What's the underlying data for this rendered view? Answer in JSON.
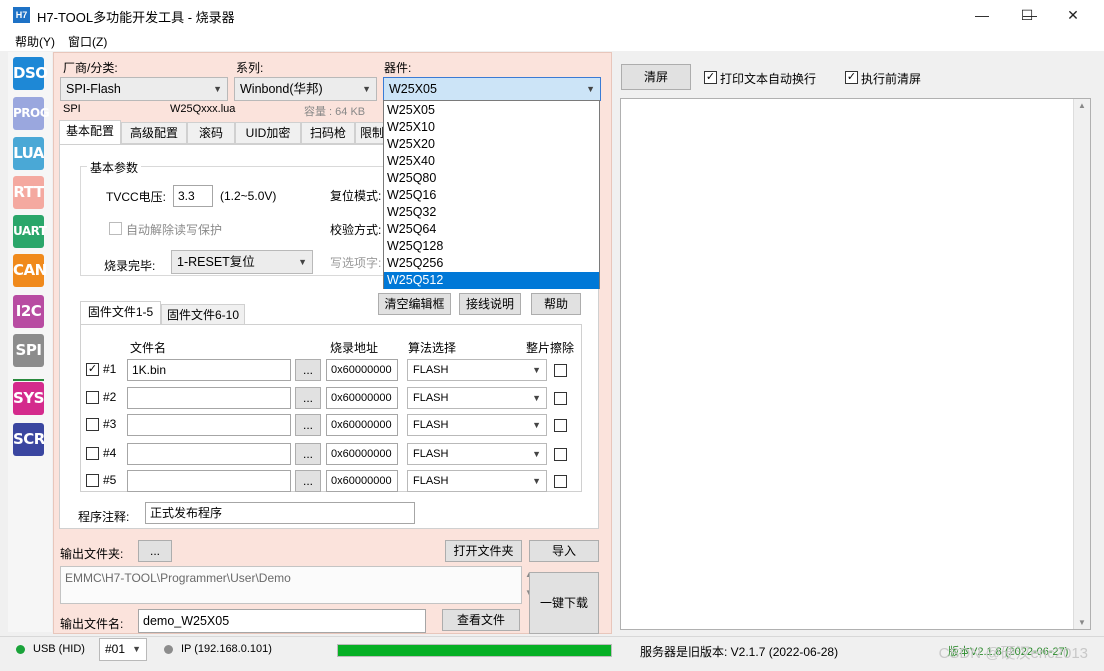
{
  "window": {
    "icon_text": "H7",
    "title": "H7-TOOL多功能开发工具 - 烧录器",
    "minimize": "—",
    "maximize": "☐",
    "close": "✕"
  },
  "menu": [
    "帮助(Y)",
    "窗口(Z)"
  ],
  "sidebar": [
    {
      "label": "DSO",
      "color": "#1e88d6"
    },
    {
      "label": "PROG",
      "color": "#9aa7de"
    },
    {
      "label": "LUA",
      "color": "#4aa8d6"
    },
    {
      "label": "RTT",
      "color": "#f4a9a0"
    },
    {
      "label": "UART",
      "color": "#2aa66a"
    },
    {
      "label": "CAN",
      "color": "#f08a1c"
    },
    {
      "label": "I2C",
      "color": "#b84ca2"
    },
    {
      "label": "SPI",
      "color": "#8c8c8c"
    },
    {
      "label": "SYS",
      "color": "#d42a8c"
    },
    {
      "label": "SCR",
      "color": "#3a46a0"
    }
  ],
  "device": {
    "vendor_label": "厂商/分类:",
    "vendor_value": "SPI-Flash",
    "series_label": "系列:",
    "series_value": "Winbond(华邦)",
    "chip_label": "器件:",
    "chip_value": "W25X05",
    "info_type": "SPI",
    "info_lua": "W25Qxxx.lua",
    "info_capacity": "容量 : 64 KB"
  },
  "chip_options": [
    "W25X05",
    "W25X10",
    "W25X20",
    "W25X40",
    "W25Q80",
    "W25Q16",
    "W25Q32",
    "W25Q64",
    "W25Q128",
    "W25Q256",
    "W25Q512"
  ],
  "chip_selected_index": 10,
  "tabs": [
    "基本配置",
    "高级配置",
    "滚码",
    "UID加密",
    "扫码枪",
    "限制"
  ],
  "basic": {
    "group_title": "基本参数",
    "tvcc_label": "TVCC电压:",
    "tvcc_value": "3.3",
    "tvcc_range": "(1.2~5.0V)",
    "reset_mode_label": "复位模式:",
    "auto_unlock_label": "自动解除读写保护",
    "verify_label": "校验方式:",
    "burn_done_label": "烧录完毕:",
    "burn_done_value": "1-RESET复位",
    "write_option_label": "写选项字:"
  },
  "buttons": {
    "clear_editor": "清空编辑框",
    "wiring": "接线说明",
    "help": "帮助",
    "browse": "...",
    "open_folder": "打开文件夹",
    "import": "导入",
    "view_file": "查看文件",
    "one_click": "一键下载",
    "clear_screen": "清屏"
  },
  "file_tabs": [
    "固件文件1-5",
    "固件文件6-10"
  ],
  "file_table": {
    "headers": [
      "文件名",
      "烧录地址",
      "算法选择",
      "整片擦除"
    ],
    "rows": [
      {
        "label": "#1",
        "checked": true,
        "file": "1K.bin",
        "addr": "0x60000000",
        "algo": "FLASH"
      },
      {
        "label": "#2",
        "checked": false,
        "file": "",
        "addr": "0x60000000",
        "algo": "FLASH"
      },
      {
        "label": "#3",
        "checked": false,
        "file": "",
        "addr": "0x60000000",
        "algo": "FLASH"
      },
      {
        "label": "#4",
        "checked": false,
        "file": "",
        "addr": "0x60000000",
        "algo": "FLASH"
      },
      {
        "label": "#5",
        "checked": false,
        "file": "",
        "addr": "0x60000000",
        "algo": "FLASH"
      }
    ]
  },
  "note_label": "程序注释:",
  "note_value": "正式发布程序",
  "output": {
    "folder_label": "输出文件夹:",
    "path": "EMMC\\H7-TOOL\\Programmer\\User\\Demo",
    "filename_label": "输出文件名:",
    "filename": "demo_W25X05"
  },
  "right": {
    "auto_wrap": "打印文本自动换行",
    "clear_before": "执行前清屏"
  },
  "status": {
    "usb": "USB (HID)",
    "device_no": "#01",
    "ip": "IP (192.168.0.101)",
    "progress": 1.0,
    "server_version": "服务器是旧版本: V2.1.7 (2022-06-28)",
    "firmware_version": "版本V2.1.8 (2022-06-27)",
    "usb_color": "#1aa33a",
    "ip_color": "#8c8c8c"
  },
  "watermark": "CSDN @硬汉eric2013"
}
